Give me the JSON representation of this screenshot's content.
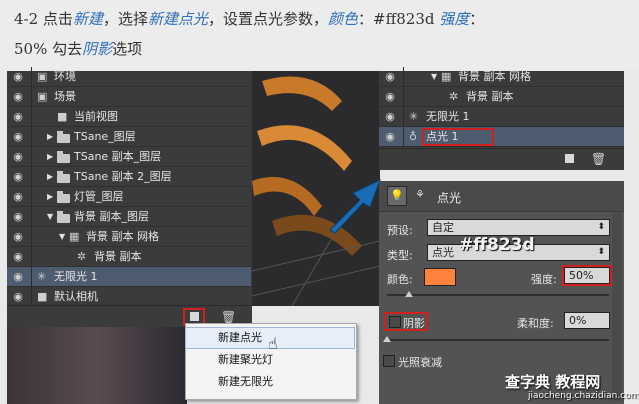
{
  "instruction": {
    "line1": [
      {
        "text": "4-2 点击",
        "hl": false
      },
      {
        "text": "新建",
        "hl": true
      },
      {
        "text": "，选择",
        "hl": false
      },
      {
        "text": "新建点光",
        "hl": true
      },
      {
        "text": "，设置点光参数，",
        "hl": false
      },
      {
        "text": "颜色",
        "hl": true
      },
      {
        "text": "：#ff823d  ",
        "hl": false
      },
      {
        "text": "强度",
        "hl": true
      },
      {
        "text": "：",
        "hl": false
      }
    ],
    "line2": [
      {
        "text": "50%  勾去",
        "hl": false
      },
      {
        "text": "阴影",
        "hl": true
      },
      {
        "text": "选项",
        "hl": false
      }
    ]
  },
  "scene_panel": {
    "rows": [
      {
        "label": "环境"
      },
      {
        "label": "场景"
      },
      {
        "label": "当前视图"
      },
      {
        "label": "TSane_图层"
      },
      {
        "label": "TSane 副本_图层"
      },
      {
        "label": "TSane 副本 2_图层"
      },
      {
        "label": "灯管_图层"
      },
      {
        "label": "背景 副本_图层"
      },
      {
        "label": "背景 副本 网格"
      },
      {
        "label": "背景 副本"
      },
      {
        "label": "无限光 1"
      },
      {
        "label": "默认相机"
      }
    ]
  },
  "context_menu": {
    "items": [
      "新建点光",
      "新建聚光灯",
      "新建无限光"
    ]
  },
  "scene_panel_right": {
    "rows": [
      {
        "label": "背景 副本 网格"
      },
      {
        "label": "背景 副本"
      },
      {
        "label": "无限光 1"
      },
      {
        "label": "点光 1"
      }
    ]
  },
  "properties": {
    "title": "点光",
    "preset_label": "预设:",
    "preset_value": "自定",
    "type_label": "类型:",
    "type_value": "点光",
    "color_overlay": "#ff823d",
    "color_label": "颜色:",
    "intensity_label": "强度:",
    "intensity_value": "50%",
    "shadow_label": "阴影",
    "softness_label": "柔和度:",
    "softness_value": "0%",
    "attenuation_label": "光照衰减",
    "light_color": "#ff823d"
  },
  "watermark": {
    "line1": "查字典 教程网",
    "line2": "jiaocheng.chazidian.com"
  }
}
